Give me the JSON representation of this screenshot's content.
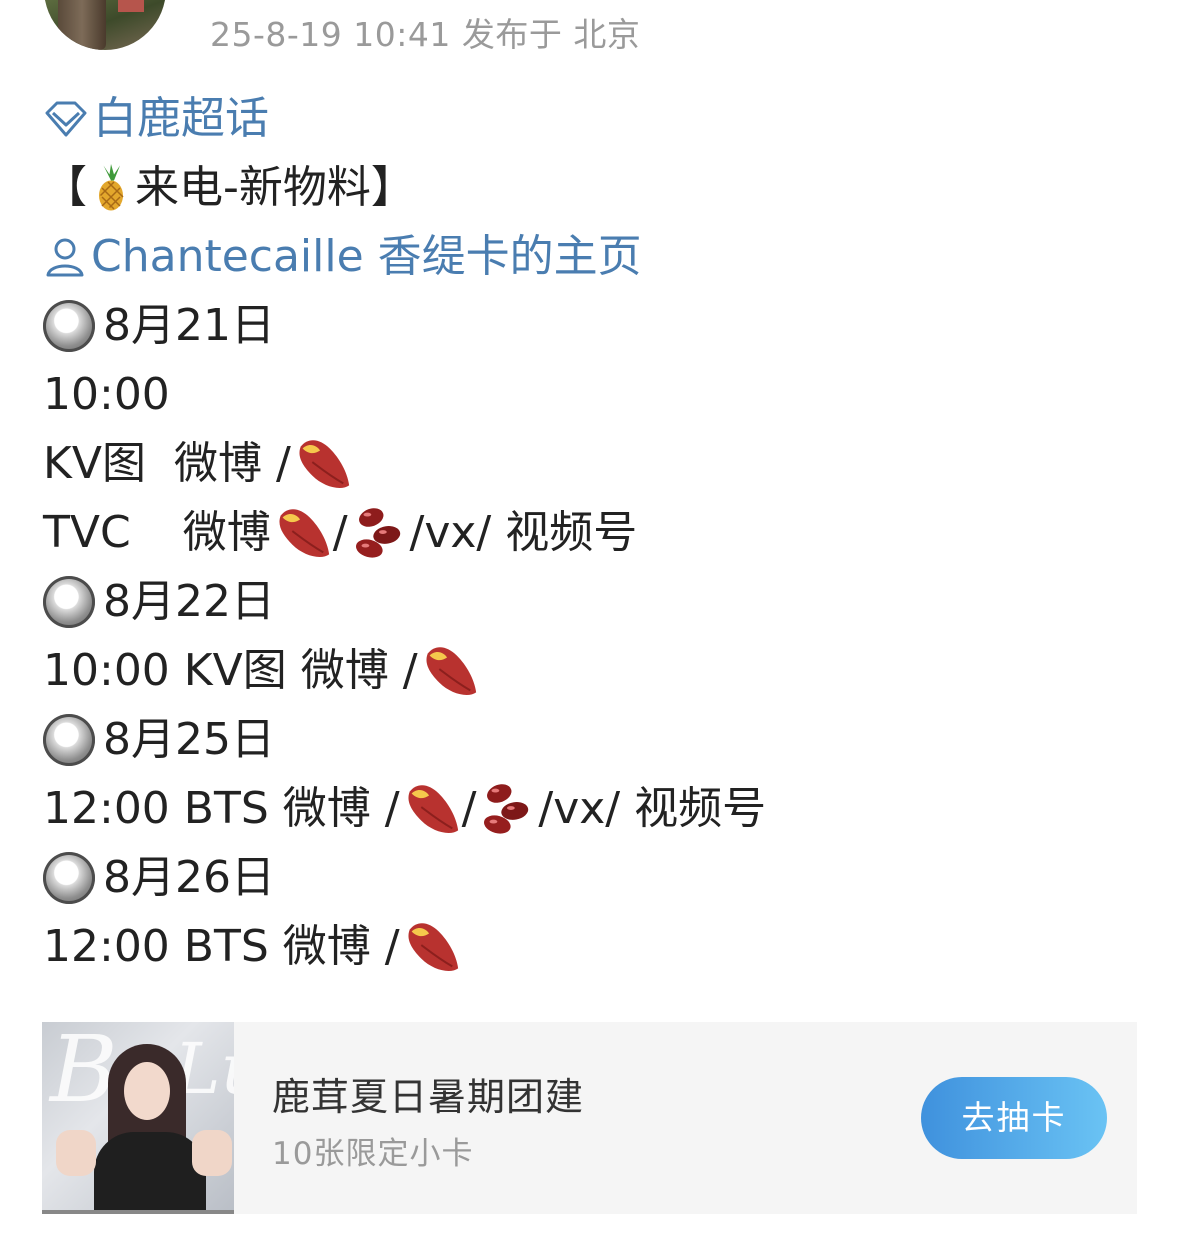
{
  "post": {
    "meta": "25-8-19 10:41  发布于 北京"
  },
  "content": {
    "topic_link": "白鹿超话",
    "headline_open": "【",
    "headline_text": " 来电-新物料】",
    "profile_link": "Chantecaille 香缇卡的主页",
    "lines": {
      "d1": "8月21日",
      "t1": "10:00",
      "kv1_a": "KV图",
      "kv1_b": "微博 /",
      "tvc_a": "TVC",
      "tvc_b": "微博 ",
      "tvc_c": "/",
      "tvc_d": "/vx/ 视频号",
      "d2": "8月22日",
      "kv2": "10:00 KV图 微博 /",
      "d3": "8月25日",
      "bts1_a": "12:00 BTS 微博 /",
      "bts1_b": "/",
      "bts1_c": "/vx/ 视频号",
      "d4": "8月26日",
      "bts2": "12:00 BTS 微博 /"
    }
  },
  "card": {
    "image_text_1": "B",
    "image_text_2": "Lu",
    "title": "鹿茸夏日暑期团建",
    "subtitle": "10张限定小卡",
    "button": "去抽卡"
  },
  "icons": {
    "topic": "diamond-icon",
    "user": "user-icon",
    "pineapple": "pineapple-emoji",
    "sweet_potato": "sweet-potato-emoji",
    "beans": "beans-emoji",
    "radio": "radio-button-emoji"
  },
  "colors": {
    "link": "#4a7db0",
    "meta": "#9a9a9a",
    "button_start": "#3f91dd",
    "button_end": "#6ac3f4"
  }
}
